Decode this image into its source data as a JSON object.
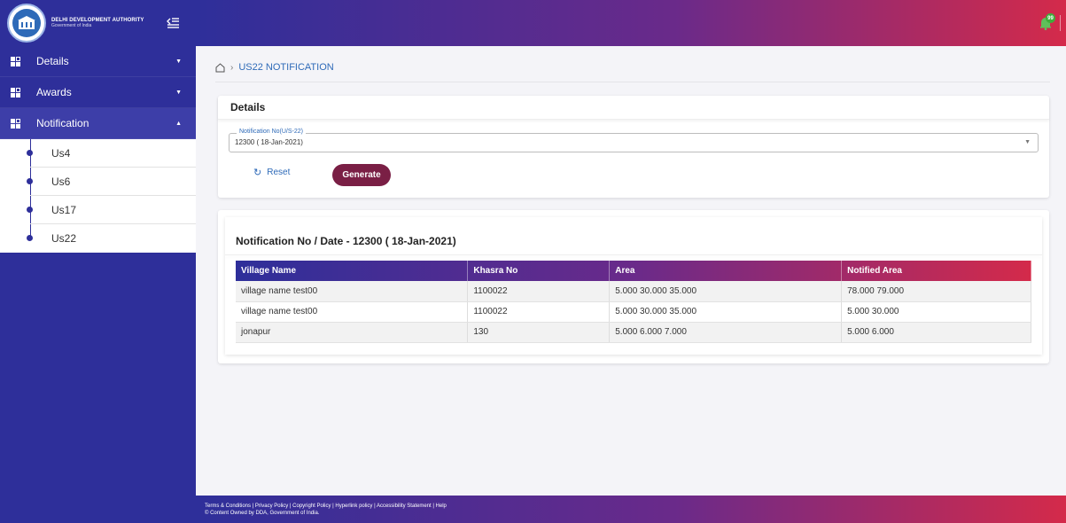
{
  "header": {
    "logo_title": "DELHI DEVELOPMENT AUTHORITY",
    "logo_subtitle": "Government of India",
    "collapse_icon": "menu-collapse-icon",
    "notification_badge": "99"
  },
  "sidebar": {
    "items": [
      {
        "label": "Details",
        "icon": "grid-icon",
        "expanded": false
      },
      {
        "label": "Awards",
        "icon": "grid-icon",
        "expanded": false
      },
      {
        "label": "Notification",
        "icon": "grid-icon",
        "expanded": true
      }
    ],
    "sub_items": [
      "Us4",
      "Us6",
      "Us17",
      "Us22"
    ]
  },
  "breadcrumb": {
    "current": "US22 NOTIFICATION"
  },
  "details_card": {
    "title": "Details",
    "field_label": "Notification No(U/S-22)",
    "field_value": "12300 ( 18-Jan-2021)",
    "reset_label": "Reset",
    "generate_label": "Generate"
  },
  "results": {
    "title": "Notification No / Date - 12300 ( 18-Jan-2021)",
    "columns": [
      "Village Name",
      "Khasra No",
      "Area",
      "Notified Area"
    ],
    "rows": [
      [
        "village name test00",
        "1100022",
        "5.000 30.000 35.000",
        "78.000 79.000"
      ],
      [
        "village name test00",
        "1100022",
        "5.000 30.000 35.000",
        "5.000 30.000"
      ],
      [
        "jonapur",
        "130",
        "5.000 6.000 7.000",
        "5.000 6.000"
      ]
    ]
  },
  "footer": {
    "links": "Terms & Conditions | Privacy Policy | Copyright Policy | Hyperlink policy | Accessibility Statement | Help",
    "copyright": "© Content Owned by DDA, Government of India."
  },
  "colors": {
    "sidebar": "#2e2f9a",
    "accent_blue": "#2e6ab8",
    "generate_button": "#7a1f45",
    "gradient_end": "#d42a4a"
  }
}
